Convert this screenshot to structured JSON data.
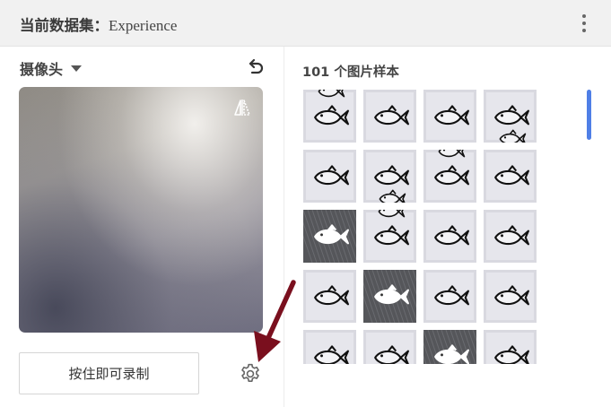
{
  "header": {
    "title_label": "当前数据集：",
    "title_value": "Experience",
    "menu_icon": "more-vert-icon"
  },
  "camera": {
    "select_label": "摄像头",
    "select_icon": "caret-down-icon",
    "undo_icon": "undo-icon",
    "flip_icon": "flip-camera-icon"
  },
  "record": {
    "button_label": "按住即可录制",
    "settings_icon": "gear-icon"
  },
  "annotation": {
    "arrow_color": "#7a0f1e"
  },
  "samples": {
    "count_label": "101 个图片样本",
    "accent_color": "#4f7fe6",
    "thumbnails": [
      {
        "bg": "light",
        "extra": "top"
      },
      {
        "bg": "light",
        "extra": "none"
      },
      {
        "bg": "light",
        "extra": "none"
      },
      {
        "bg": "light",
        "extra": "bottom"
      },
      {
        "bg": "light",
        "extra": "none"
      },
      {
        "bg": "light",
        "extra": "bottom"
      },
      {
        "bg": "light",
        "extra": "top"
      },
      {
        "bg": "light",
        "extra": "none"
      },
      {
        "bg": "dark",
        "extra": "none"
      },
      {
        "bg": "light",
        "extra": "top"
      },
      {
        "bg": "light",
        "extra": "none"
      },
      {
        "bg": "light",
        "extra": "none"
      },
      {
        "bg": "light",
        "extra": "none"
      },
      {
        "bg": "dark",
        "extra": "none"
      },
      {
        "bg": "light",
        "extra": "none"
      },
      {
        "bg": "light",
        "extra": "none"
      },
      {
        "bg": "light",
        "extra": "none"
      },
      {
        "bg": "light",
        "extra": "none"
      },
      {
        "bg": "dark",
        "extra": "none"
      },
      {
        "bg": "light",
        "extra": "none"
      }
    ]
  }
}
